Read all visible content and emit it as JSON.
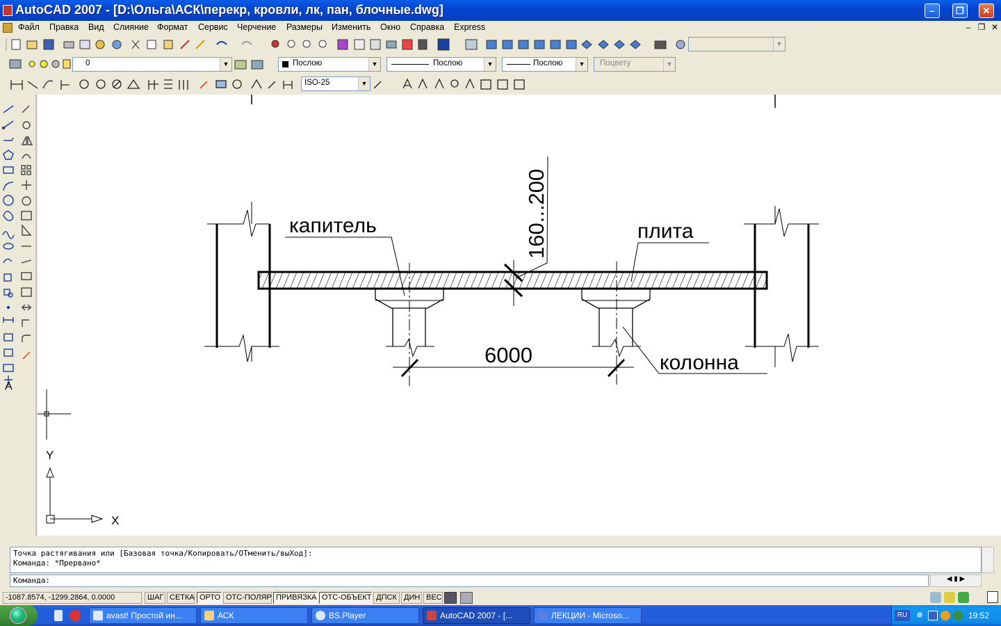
{
  "window": {
    "title": "AutoCAD 2007 - [D:\\Ольга\\АСК\\перекр, кровли, лк, пан, блочные.dwg]",
    "min_glyph": "–",
    "max_glyph": "❐",
    "close_glyph": "✕"
  },
  "menu": {
    "items": [
      "Файл",
      "Правка",
      "Вид",
      "Слияние",
      "Формат",
      "Сервис",
      "Черчение",
      "Размеры",
      "Изменить",
      "Окно",
      "Справка",
      "Express"
    ],
    "mdi_min": "–",
    "mdi_restore": "❐",
    "mdi_close": "✕"
  },
  "properties_toolbar": {
    "layer_value": "0",
    "color_value": "Послою",
    "linetype_value": "Послою",
    "lineweight_value": "Послою",
    "plotstyle_value": "Поцвету"
  },
  "styles_toolbar": {
    "dimstyle_value": "ISO-25"
  },
  "drawing": {
    "labels": {
      "capital": "капитель",
      "slab": "плита",
      "column": "колонна",
      "thickness": "160...200",
      "span": "6000"
    },
    "ucs": {
      "x_label": "X",
      "y_label": "Y"
    }
  },
  "command": {
    "history": [
      "Точка растягивания или [Базовая точка/Копировать/ОТменить/выХод]:",
      "Команда: *Прервано*"
    ],
    "prompt": "Команда:"
  },
  "status": {
    "coordinates": "-1087.8574, -1299.2864, 0.0000",
    "buttons": [
      {
        "label": "ШАГ",
        "on": false
      },
      {
        "label": "СЕТКА",
        "on": false
      },
      {
        "label": "ОРТО",
        "on": true
      },
      {
        "label": "ОТС-ПОЛЯР",
        "on": false
      },
      {
        "label": "ПРИВЯЗКА",
        "on": true
      },
      {
        "label": "ОТС-ОБЪЕКТ",
        "on": true
      },
      {
        "label": "ДПСК",
        "on": false
      },
      {
        "label": "ДИН",
        "on": false
      },
      {
        "label": "ВЕС",
        "on": false
      }
    ]
  },
  "taskbar": {
    "tasks": [
      {
        "label": "avast! Простой ин...",
        "active": false
      },
      {
        "label": "АСК",
        "active": false
      },
      {
        "label": "BS.Player",
        "active": false
      },
      {
        "label": "AutoCAD 2007 - [...",
        "active": true
      },
      {
        "label": "ЛЕКЦИИ - Microso...",
        "active": false
      }
    ],
    "language": "RU",
    "clock": "19:52"
  },
  "colors": {
    "title_blue": "#0546d0",
    "chrome": "#ece9d8",
    "taskbar_blue": "#245edb",
    "start_green": "#3c8f3a"
  }
}
